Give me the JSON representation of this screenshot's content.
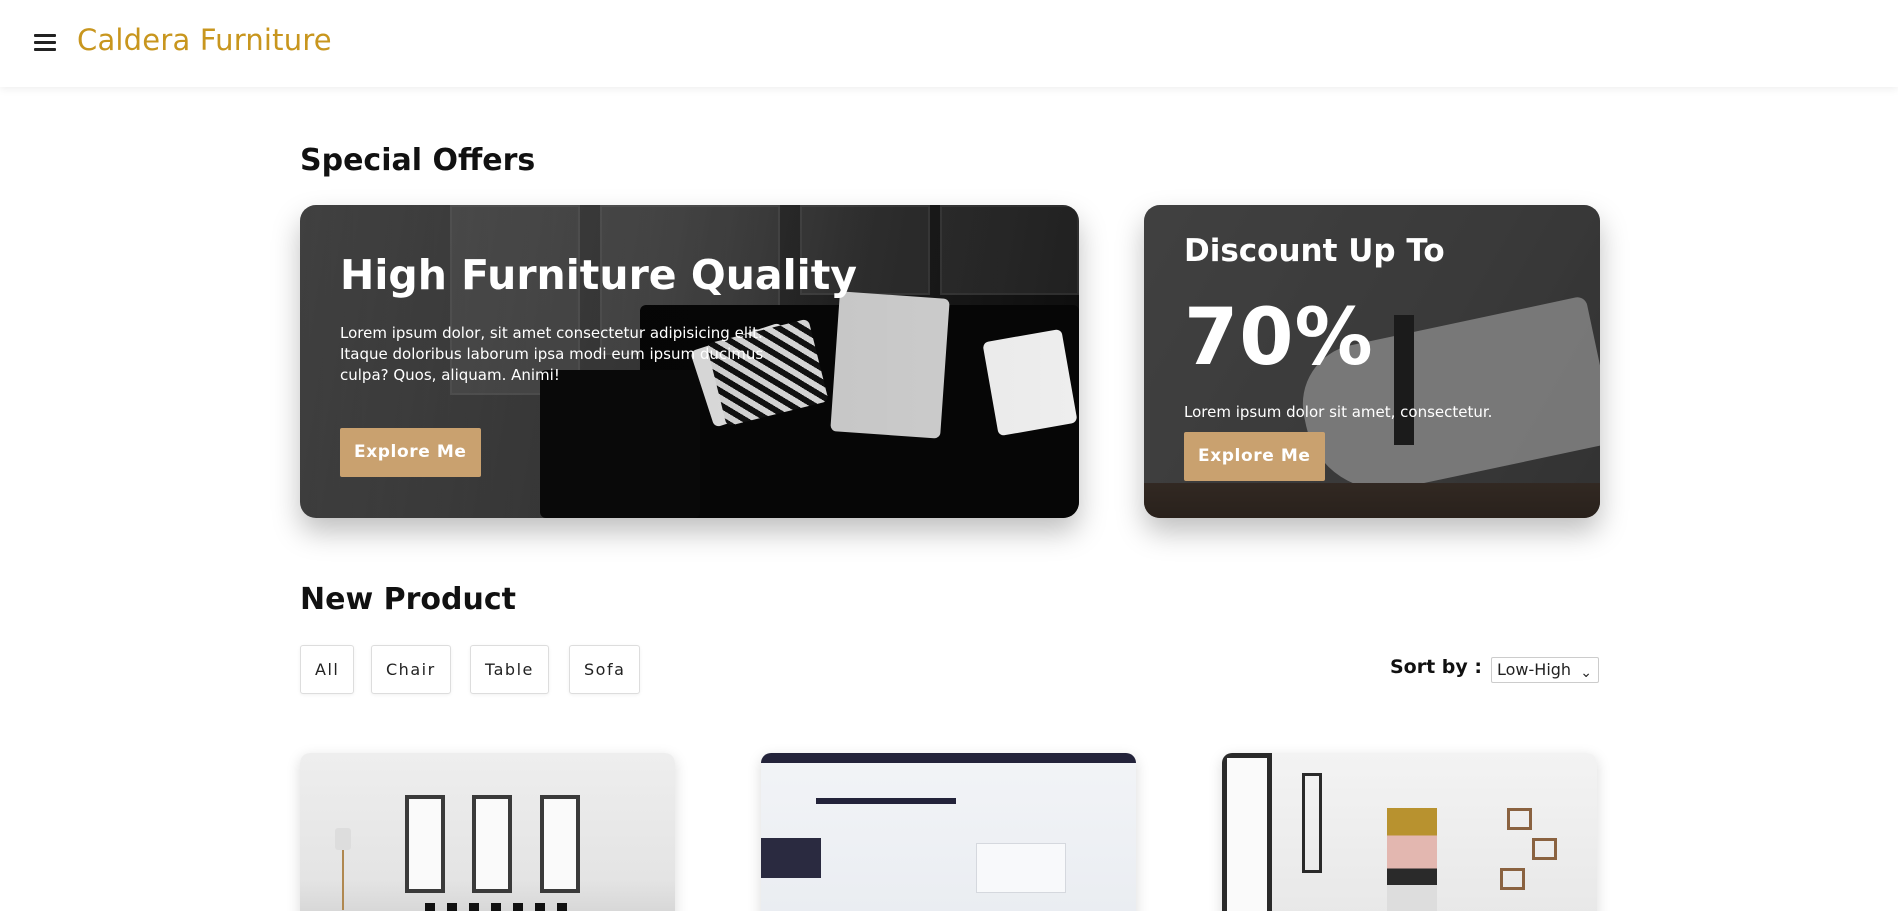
{
  "header": {
    "brand": "Caldera Furniture",
    "menu_icon": "hamburger-menu-icon",
    "brand_color": "#c8961e"
  },
  "special_offers": {
    "title": "Special Offers",
    "main_offer": {
      "heading": "High Furniture Quality",
      "text_lines": [
        "Lorem ipsum dolor, sit amet consectetur adipisicing elit.",
        "Itaque doloribus laborum ipsa modi eum ipsum ducimus",
        "culpa? Quos, aliquam. Animi!"
      ],
      "button": "Explore Me"
    },
    "discount_offer": {
      "heading": "Discount Up To",
      "percent": "70%",
      "text": "Lorem ipsum dolor sit amet, consectetur.",
      "button": "Explore Me"
    },
    "button_color": "#c9a16f"
  },
  "new_product": {
    "title": "New Product",
    "filters": [
      "All",
      "Chair",
      "Table",
      "Sofa"
    ],
    "sort_label": "Sort by :",
    "sort_value": "Low-High",
    "sort_icon": "chevron-down-icon"
  }
}
